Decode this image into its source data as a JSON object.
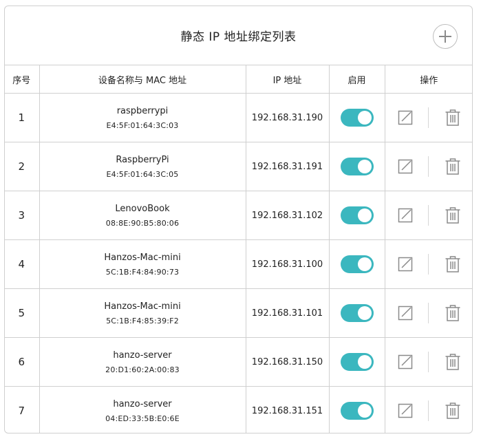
{
  "header": {
    "title": "静态 IP 地址绑定列表",
    "add_icon": "plus-circle-icon"
  },
  "columns": {
    "index": "序号",
    "device": "设备名称与 MAC 地址",
    "ip": "IP 地址",
    "enabled": "启用",
    "actions": "操作"
  },
  "colors": {
    "toggle_on": "#3bb7bf",
    "border": "#cfcfcf"
  },
  "rows": [
    {
      "index": "1",
      "name": "raspberrypi",
      "mac": "E4:5F:01:64:3C:03",
      "ip": "192.168.31.190",
      "enabled": true
    },
    {
      "index": "2",
      "name": "RaspberryPi",
      "mac": "E4:5F:01:64:3C:05",
      "ip": "192.168.31.191",
      "enabled": true
    },
    {
      "index": "3",
      "name": "LenovoBook",
      "mac": "08:8E:90:B5:80:06",
      "ip": "192.168.31.102",
      "enabled": true
    },
    {
      "index": "4",
      "name": "Hanzos-Mac-mini",
      "mac": "5C:1B:F4:84:90:73",
      "ip": "192.168.31.100",
      "enabled": true
    },
    {
      "index": "5",
      "name": "Hanzos-Mac-mini",
      "mac": "5C:1B:F4:85:39:F2",
      "ip": "192.168.31.101",
      "enabled": true
    },
    {
      "index": "6",
      "name": "hanzo-server",
      "mac": "20:D1:60:2A:00:83",
      "ip": "192.168.31.150",
      "enabled": true
    },
    {
      "index": "7",
      "name": "hanzo-server",
      "mac": "04:ED:33:5B:E0:6E",
      "ip": "192.168.31.151",
      "enabled": true
    }
  ]
}
